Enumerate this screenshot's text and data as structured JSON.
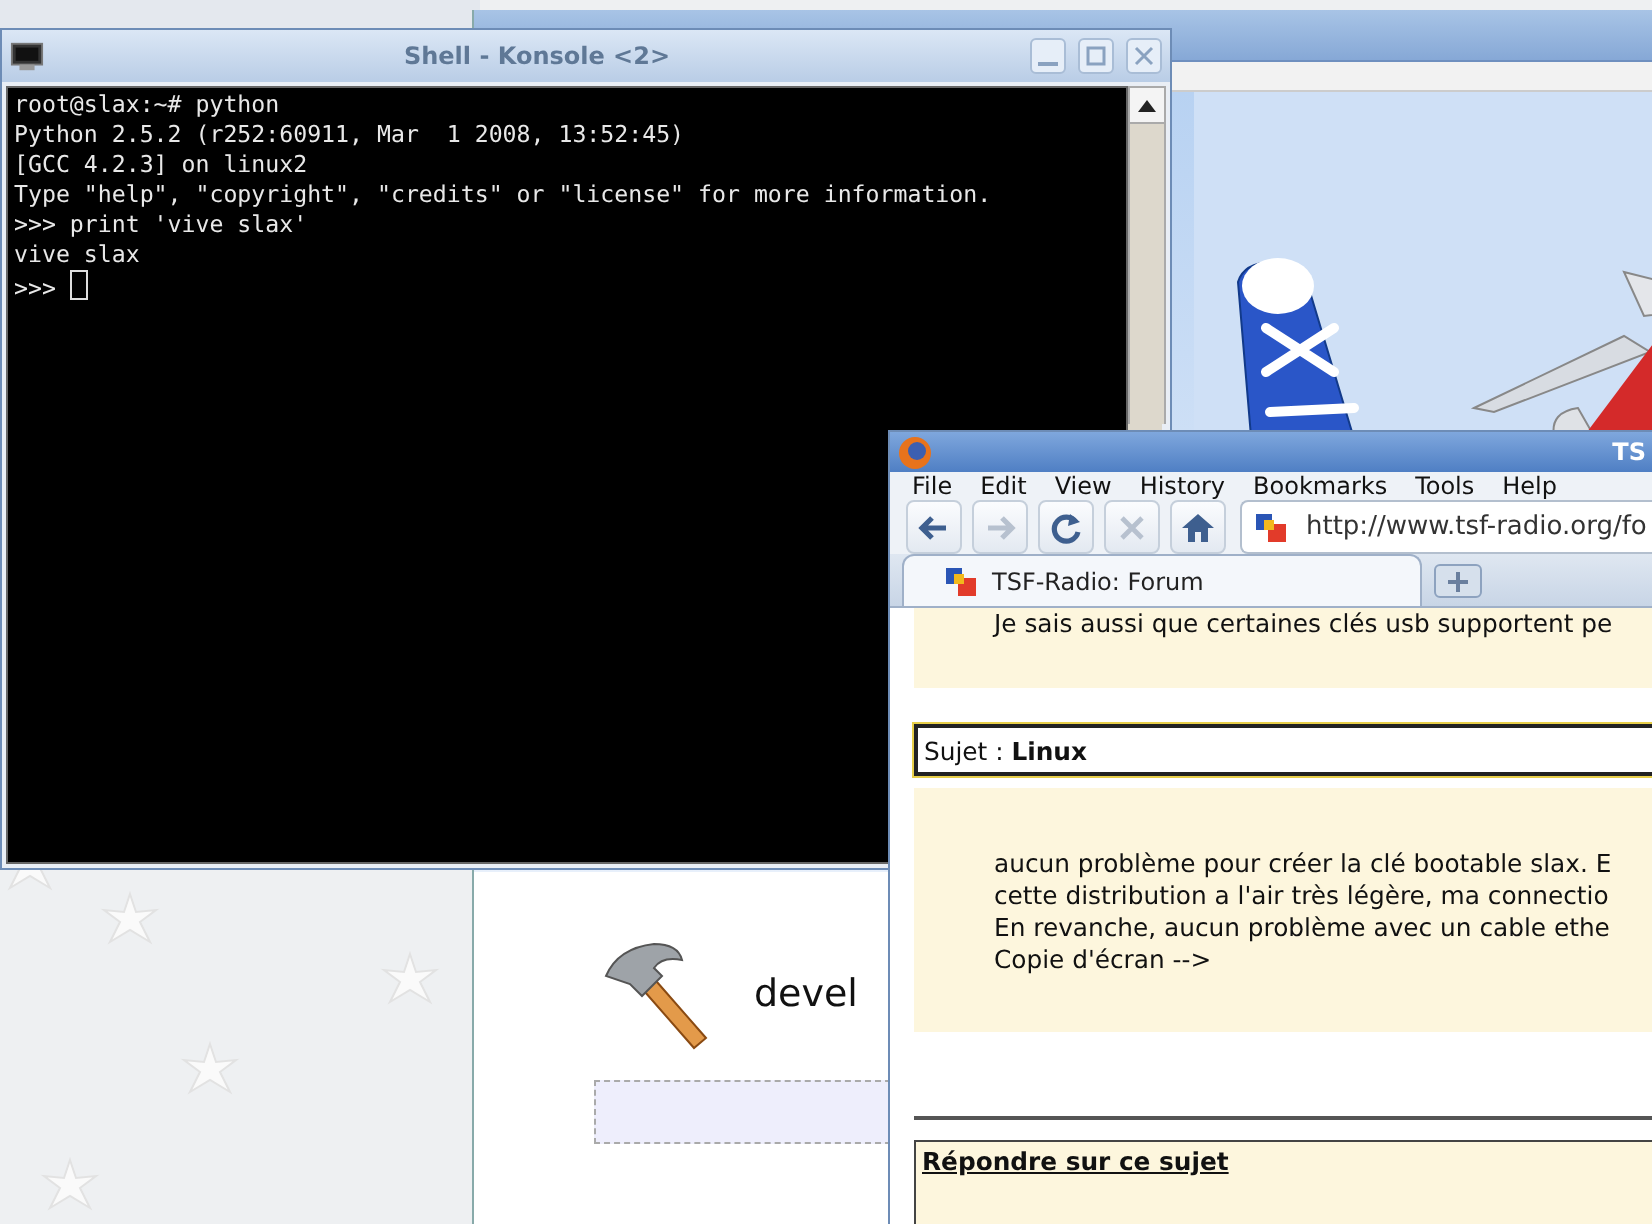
{
  "background_window": {
    "heading": "devel"
  },
  "konsole": {
    "title": "Shell - Konsole <2>",
    "active": false,
    "lines": [
      "root@slax:~# python",
      "Python 2.5.2 (r252:60911, Mar  1 2008, 13:52:45)",
      "[GCC 4.2.3] on linux2",
      "Type \"help\", \"copyright\", \"credits\" or \"license\" for more information.",
      ">>> print 'vive slax'",
      "vive slax",
      ">>> "
    ]
  },
  "firefox": {
    "title": "TS",
    "active": true,
    "menu": [
      "File",
      "Edit",
      "View",
      "History",
      "Bookmarks",
      "Tools",
      "Help"
    ],
    "toolbar": [
      {
        "kind": "back",
        "disabled": false
      },
      {
        "kind": "forward",
        "disabled": true
      },
      {
        "kind": "reload",
        "disabled": false
      },
      {
        "kind": "stop",
        "disabled": true
      },
      {
        "kind": "home",
        "disabled": false
      }
    ],
    "url": "http://www.tsf-radio.org/fo",
    "tabs": [
      {
        "label": "TSF-Radio: Forum",
        "selected": true
      }
    ],
    "page": {
      "previous_post_line": "Je sais aussi que certaines clés usb supportent pe",
      "subject": "Sujet : **Linux**",
      "post_lines": [
        "aucun problème pour créer la clé bootable slax. E",
        "cette distribution a l'air très légère, ma connectio",
        "En revanche, aucun problème avec un cable ethe",
        "Copie d'écran -->"
      ],
      "reply_heading": "Répondre sur ce sujet"
    }
  }
}
